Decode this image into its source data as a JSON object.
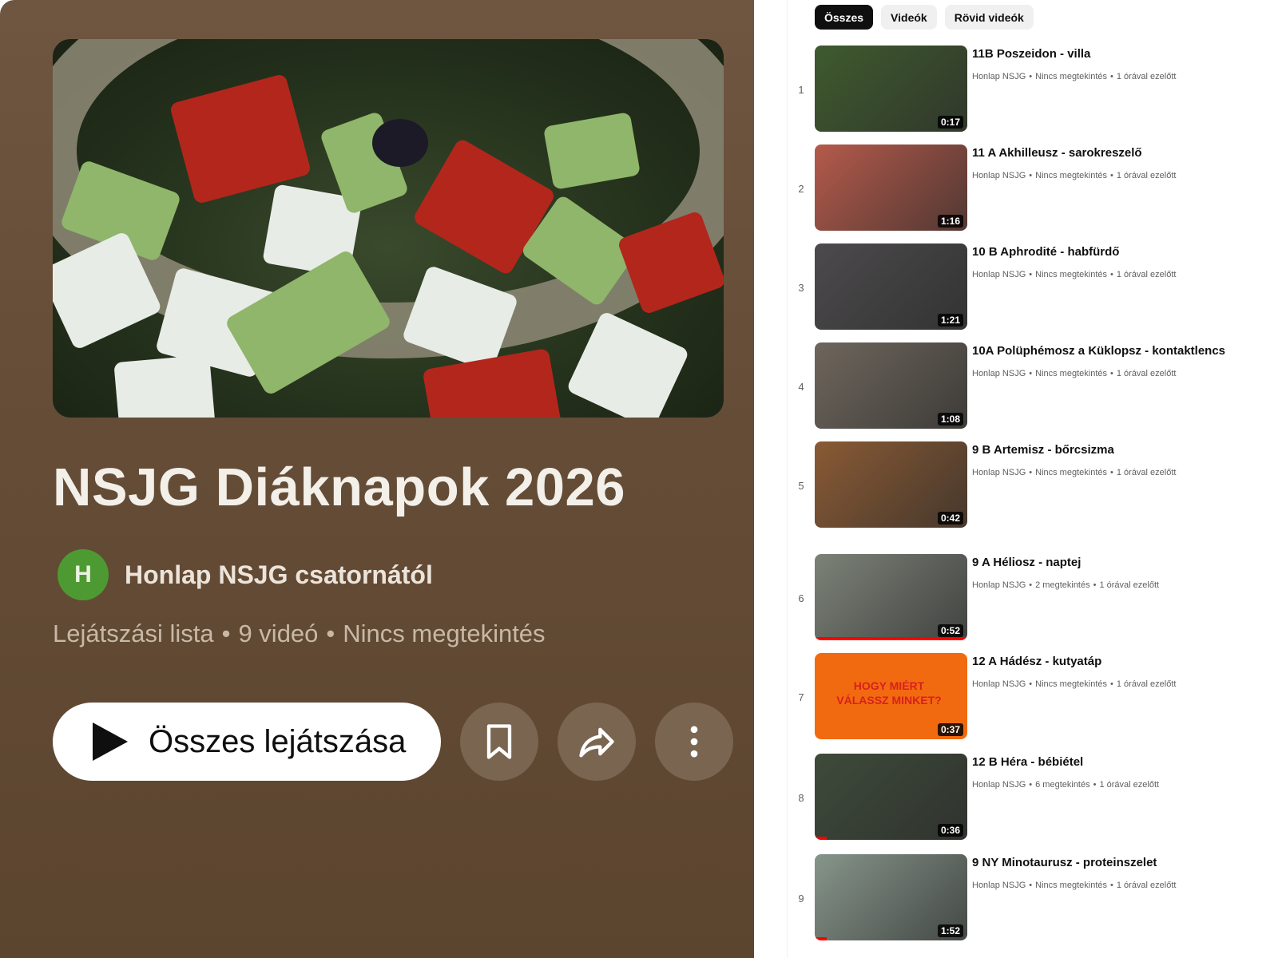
{
  "playlist": {
    "title": "NSJG Diáknapok 2026",
    "avatar_letter": "H",
    "channel": "Honlap NSJG csatornától",
    "meta": {
      "kind": "Lejátszási lista",
      "count": "9 videó",
      "views": "Nincs megtekintés",
      "separator": "•"
    },
    "play_all_label": "Összes lejátszása",
    "colors": {
      "avatar": "#4e9a32",
      "panel": "#654d37"
    }
  },
  "chips": [
    {
      "label": "Összes",
      "active": true
    },
    {
      "label": "Videók",
      "active": false
    },
    {
      "label": "Rövid videók",
      "active": false
    }
  ],
  "videos": [
    {
      "index": "1",
      "title": "11B Poszeidon - villa",
      "channel": "Honlap NSJG",
      "views": "Nincs megtekintés",
      "age": "1 órával ezelőtt",
      "duration": "0:17",
      "thumb_color": "#3f5a2e",
      "watched_fraction": 0
    },
    {
      "index": "2",
      "title": "11 A Akhilleusz - sarokreszelő",
      "channel": "Honlap NSJG",
      "views": "Nincs megtekintés",
      "age": "1 órával ezelőtt",
      "duration": "1:16",
      "thumb_color": "#b45a4a",
      "watched_fraction": 0
    },
    {
      "index": "3",
      "title": "10 B Aphrodité - habfürdő",
      "channel": "Honlap NSJG",
      "views": "Nincs megtekintés",
      "age": "1 órával ezelőtt",
      "duration": "1:21",
      "thumb_color": "#4c4a4c",
      "watched_fraction": 0
    },
    {
      "index": "4",
      "title": "10A Polüphémosz a Küklopsz - kontaktlencs",
      "channel": "Honlap NSJG",
      "views": "Nincs megtekintés",
      "age": "1 órával ezelőtt",
      "duration": "1:08",
      "thumb_color": "#6e665c",
      "watched_fraction": 0
    },
    {
      "index": "5",
      "title": "9 B Artemisz - bőrcsizma",
      "channel": "Honlap NSJG",
      "views": "Nincs megtekintés",
      "age": "1 órával ezelőtt",
      "duration": "0:42",
      "thumb_color": "#8a5a34",
      "watched_fraction": 0
    },
    {
      "index": "6",
      "title": "9 A Héliosz - naptej",
      "channel": "Honlap NSJG",
      "views": "2 megtekintés",
      "age": "1 órával ezelőtt",
      "duration": "0:52",
      "thumb_color": "#7c8278",
      "watched_fraction": 1
    },
    {
      "index": "7",
      "title": "12 A Hádész - kutyatáp",
      "channel": "Honlap NSJG",
      "views": "Nincs megtekintés",
      "age": "1 órával ezelőtt",
      "duration": "0:37",
      "thumb_color": "#f26a0f",
      "thumb_text": "HOGY MIÉRT VÁLASSZ MINKET?",
      "watched_fraction": 0
    },
    {
      "index": "8",
      "title": "12 B Héra - bébiétel",
      "channel": "Honlap NSJG",
      "views": "6 megtekintés",
      "age": "1 órával ezelőtt",
      "duration": "0:36",
      "thumb_color": "#3e4a3a",
      "watched_fraction": 0.08
    },
    {
      "index": "9",
      "title": "9 NY Minotaurusz - proteinszelet",
      "channel": "Honlap NSJG",
      "views": "Nincs megtekintés",
      "age": "1 órával ezelőtt",
      "duration": "1:52",
      "thumb_color": "#86958a",
      "watched_fraction": 0.08
    }
  ]
}
